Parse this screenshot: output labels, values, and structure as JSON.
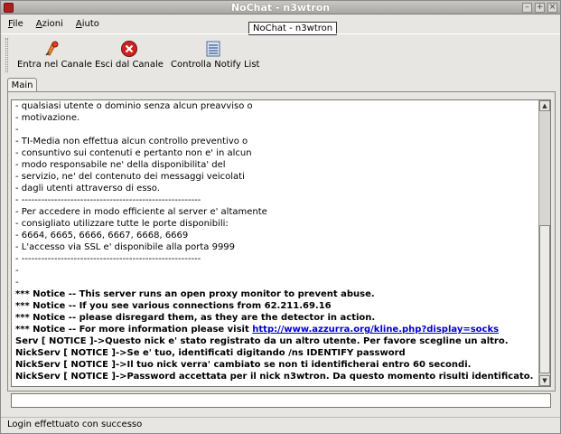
{
  "window": {
    "title": "NoChat - n3wtron",
    "controls": [
      "minimize-icon",
      "maximize-icon",
      "close-icon"
    ]
  },
  "menu": {
    "items": [
      {
        "label_u": "F",
        "label_rest": "ile"
      },
      {
        "label_u": "A",
        "label_rest": "zioni"
      },
      {
        "label_u": "A",
        "label_rest": "iuto"
      }
    ]
  },
  "tooltip": "NoChat - n3wtron",
  "toolbar": {
    "buttons": [
      {
        "label": "Entra nel Canale",
        "icon": "enter-channel-icon"
      },
      {
        "label": "Esci dal Canale",
        "icon": "exit-channel-icon"
      },
      {
        "label": "Controlla Notify List",
        "icon": "notify-list-icon"
      }
    ]
  },
  "tabs": [
    {
      "label": "Main"
    }
  ],
  "log": {
    "lines": [
      {
        "text": "- qualsiasi utente o dominio senza alcun preavviso o",
        "bold": false
      },
      {
        "text": "- motivazione.",
        "bold": false
      },
      {
        "text": "-",
        "bold": false
      },
      {
        "text": "- TI-Media non effettua alcun controllo preventivo o",
        "bold": false
      },
      {
        "text": "- consuntivo sui contenuti e pertanto non e' in alcun",
        "bold": false
      },
      {
        "text": "- modo responsabile ne' della disponibilita' del",
        "bold": false
      },
      {
        "text": "- servizio, ne' del contenuto dei messaggi veicolati",
        "bold": false
      },
      {
        "text": "- dagli utenti attraverso di esso.",
        "bold": false
      },
      {
        "text": "- -------------------------------------------------------",
        "bold": false
      },
      {
        "text": "- Per accedere in modo efficiente al server e' altamente",
        "bold": false
      },
      {
        "text": "- consigliato utilizzare tutte le porte disponibili:",
        "bold": false
      },
      {
        "text": "- 6664, 6665, 6666, 6667, 6668, 6669",
        "bold": false
      },
      {
        "text": "- L'accesso via SSL e' disponibile alla porta 9999",
        "bold": false
      },
      {
        "text": "- -------------------------------------------------------",
        "bold": false
      },
      {
        "text": "-",
        "bold": false
      },
      {
        "text": "-",
        "bold": false
      },
      {
        "text": "*** Notice -- This server runs an open proxy monitor to prevent abuse.",
        "bold": true
      },
      {
        "text": "*** Notice -- If you see various connections from 62.211.69.16",
        "bold": true
      },
      {
        "text": "*** Notice -- please disregard them, as they are the detector in action.",
        "bold": true
      },
      {
        "text": "*** Notice -- For more information please visit ",
        "bold": true,
        "link": "http://www.azzurra.org/kline.php?display=socks"
      },
      {
        "text": "Serv [ NOTICE ]->Questo nick e' stato registrato da un altro utente. Per favore scegline un altro.",
        "bold": true
      },
      {
        "text": "NickServ [ NOTICE ]->Se e' tuo, identificati digitando /ns IDENTIFY password",
        "bold": true
      },
      {
        "text": "NickServ [ NOTICE ]->Il tuo nick verra' cambiato se non ti identificherai entro 60 secondi.",
        "bold": true
      },
      {
        "text": "NickServ [ NOTICE ]->Password accettata per il nick n3wtron. Da questo momento risulti identificato.",
        "bold": true
      }
    ]
  },
  "input": {
    "value": ""
  },
  "status": {
    "text": "Login effettuato con successo"
  },
  "colors": {
    "link": "#0000cc",
    "close_red": "#cc2222"
  }
}
